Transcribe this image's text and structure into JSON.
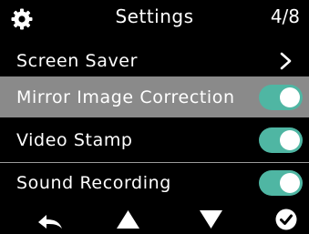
{
  "header": {
    "title": "Settings",
    "page": "4/8",
    "icon": "gear-icon"
  },
  "menu": {
    "items": [
      {
        "label": "Screen Saver",
        "control": "chevron-right-icon"
      },
      {
        "label": "Mirror Image Correction",
        "control": "toggle",
        "enabled": true,
        "selected": true
      },
      {
        "label": "Video Stamp",
        "control": "toggle",
        "enabled": true
      },
      {
        "label": "Sound Recording",
        "control": "toggle",
        "enabled": true
      }
    ]
  },
  "footer": {
    "buttons": [
      "back-icon",
      "up-arrow-icon",
      "down-arrow-icon",
      "confirm-check-icon"
    ]
  },
  "colors": {
    "background": "#000000",
    "selected_row": "#8a8a8a",
    "toggle_on": "#4fb6a3",
    "text": "#ffffff"
  }
}
